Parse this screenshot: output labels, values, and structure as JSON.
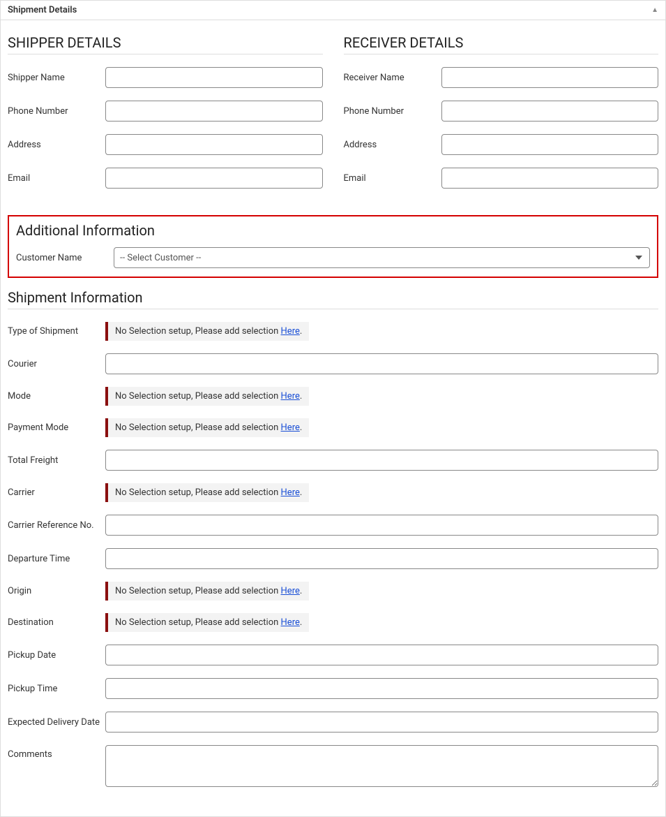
{
  "panel_title": "Shipment Details",
  "shipper": {
    "heading": "SHIPPER DETAILS",
    "name_label": "Shipper Name",
    "phone_label": "Phone Number",
    "address_label": "Address",
    "email_label": "Email"
  },
  "receiver": {
    "heading": "RECEIVER DETAILS",
    "name_label": "Receiver Name",
    "phone_label": "Phone Number",
    "address_label": "Address",
    "email_label": "Email"
  },
  "additional": {
    "heading": "Additional Information",
    "customer_label": "Customer Name",
    "customer_placeholder": "-- Select Customer --"
  },
  "shipment_info": {
    "heading": "Shipment Information",
    "type_label": "Type of Shipment",
    "courier_label": "Courier",
    "mode_label": "Mode",
    "payment_mode_label": "Payment Mode",
    "total_freight_label": "Total Freight",
    "carrier_label": "Carrier",
    "carrier_ref_label": "Carrier Reference No.",
    "departure_label": "Departure Time",
    "origin_label": "Origin",
    "destination_label": "Destination",
    "pickup_date_label": "Pickup Date",
    "pickup_time_label": "Pickup Time",
    "expected_label": "Expected Delivery Date",
    "comments_label": "Comments"
  },
  "notice": {
    "text": "No Selection setup, Please add selection ",
    "link": "Here",
    "suffix": "."
  }
}
